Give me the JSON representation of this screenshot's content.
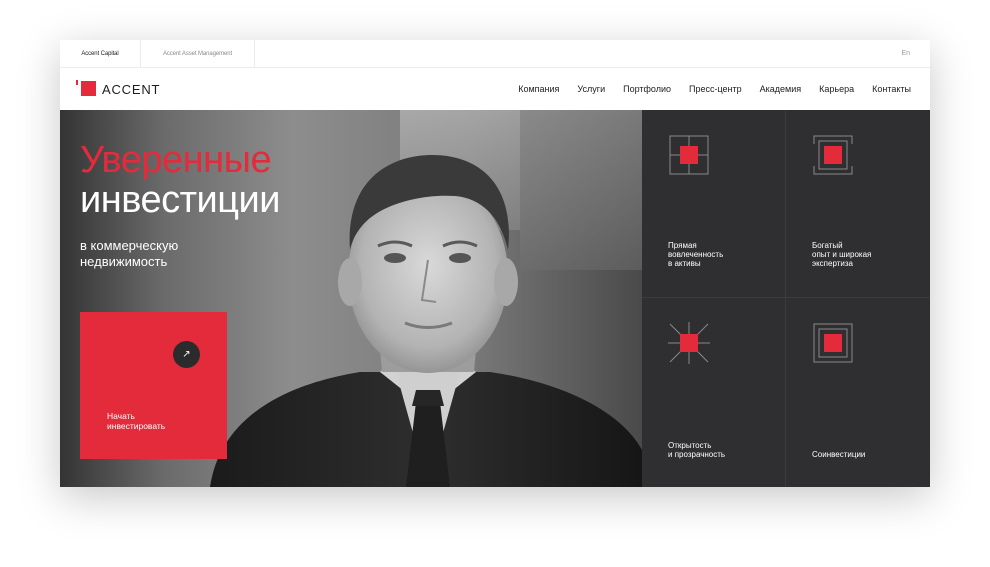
{
  "topbar": {
    "tabs": [
      "Accent Capital",
      "Accent Asset Management"
    ],
    "lang": "En"
  },
  "header": {
    "logo_text": "ACCENT",
    "nav": [
      "Компания",
      "Услуги",
      "Портфолио",
      "Пресс-центр",
      "Академия",
      "Карьера",
      "Контакты"
    ]
  },
  "hero": {
    "headline_accent": "Уверенные",
    "headline_main": "инвестиции",
    "subtitle_line1": "в коммерческую",
    "subtitle_line2": "недвижимость",
    "cta_line1": "Начать",
    "cta_line2": "инвестировать",
    "cta_icon": "arrow-up-right-icon"
  },
  "features": [
    {
      "line1": "Прямая",
      "line2": "вовлеченность",
      "line3": "в активы",
      "icon": "crosshair-square-icon"
    },
    {
      "line1": "Богатый",
      "line2": "опыт и широкая",
      "line3": "экспертиза",
      "icon": "framed-square-icon"
    },
    {
      "line1": "Открытость",
      "line2": "и прозрачность",
      "line3": "",
      "icon": "burst-square-icon"
    },
    {
      "line1": "Соинвестиции",
      "line2": "",
      "line3": "",
      "icon": "nested-square-icon"
    }
  ],
  "colors": {
    "accent": "#e32b3b",
    "dark_panel": "#2f2f31",
    "text": "#1d1d1f"
  }
}
